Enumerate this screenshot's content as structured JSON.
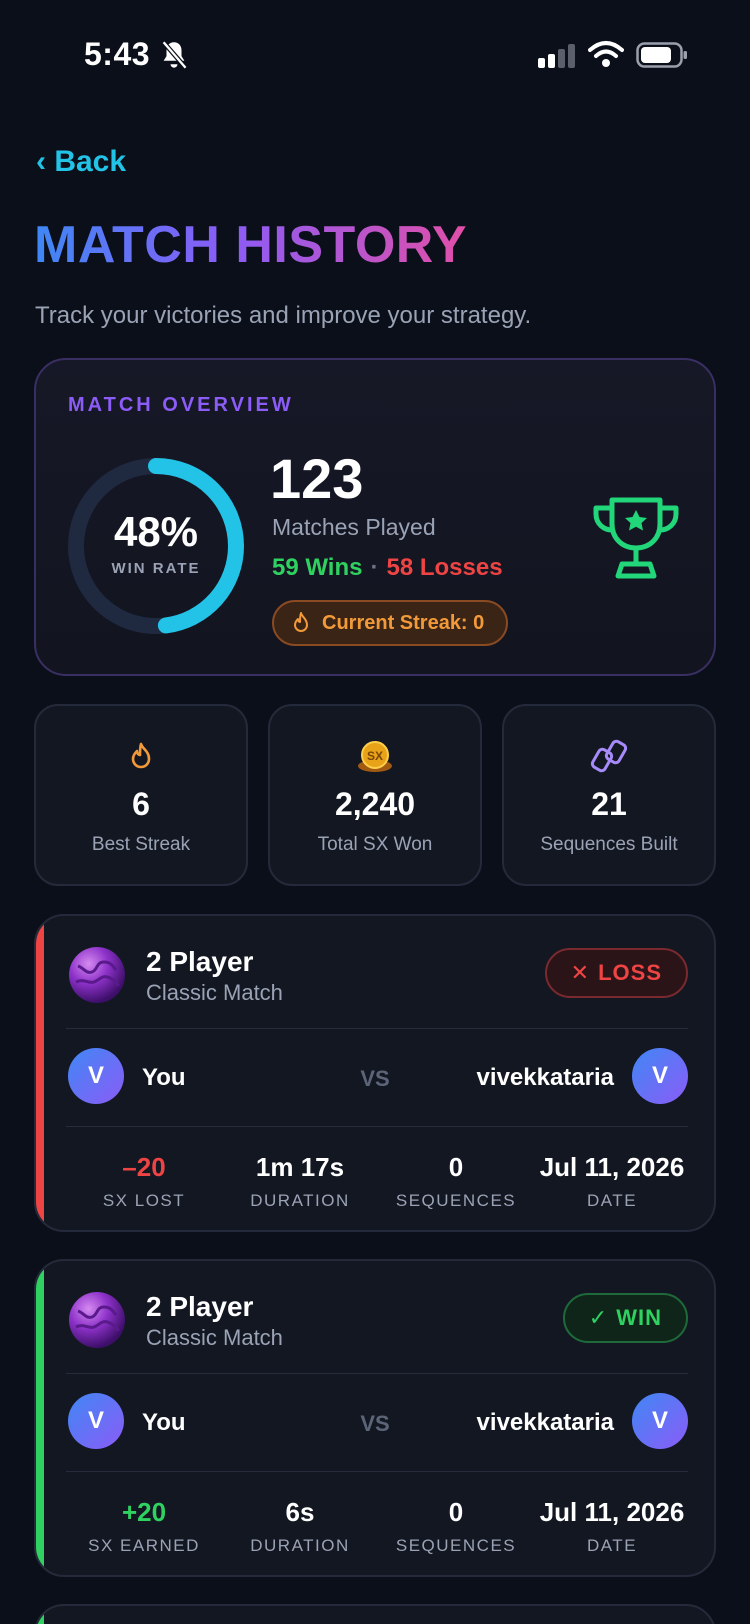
{
  "status_bar": {
    "time": "5:43"
  },
  "nav": {
    "back_label": "‹ Back"
  },
  "header": {
    "title": "MATCH HISTORY",
    "subtitle": "Track your victories and improve your strategy."
  },
  "overview": {
    "label": "MATCH OVERVIEW",
    "win_rate_text": "48%",
    "win_rate_fraction": 0.48,
    "win_rate_caption": "WIN RATE",
    "matches_played": "123",
    "matches_caption": "Matches Played",
    "wins": "59 Wins",
    "separator": "·",
    "losses": "58 Losses",
    "current_streak": "Current Streak: 0"
  },
  "stats": [
    {
      "icon": "flame-icon",
      "value": "6",
      "caption": "Best Streak"
    },
    {
      "icon": "sx-coin-icon",
      "coin_text": "SX",
      "value": "2,240",
      "caption": "Total SX Won"
    },
    {
      "icon": "link-icon",
      "value": "21",
      "caption": "Sequences Built"
    }
  ],
  "matches": [
    {
      "mode": "2 Player",
      "type": "Classic Match",
      "result": "LOSS",
      "result_icon": "✕",
      "player": "You",
      "player_initial": "V",
      "vs": "VS",
      "opponent": "vivekkataria",
      "opponent_initial": "V",
      "sx_value": "–20",
      "sx_caption": "SX LOST",
      "duration": "1m 17s",
      "duration_caption": "DURATION",
      "sequences": "0",
      "sequences_caption": "SEQUENCES",
      "date": "Jul 11, 2026",
      "date_caption": "DATE"
    },
    {
      "mode": "2 Player",
      "type": "Classic Match",
      "result": "WIN",
      "result_icon": "✓",
      "player": "You",
      "player_initial": "V",
      "vs": "VS",
      "opponent": "vivekkataria",
      "opponent_initial": "V",
      "sx_value": "+20",
      "sx_caption": "SX EARNED",
      "duration": "6s",
      "duration_caption": "DURATION",
      "sequences": "0",
      "sequences_caption": "SEQUENCES",
      "date": "Jul 11, 2026",
      "date_caption": "DATE"
    }
  ],
  "colors": {
    "accent_cyan": "#22c3e6",
    "purple": "#8b5cf6",
    "win_green": "#2fd160",
    "loss_red": "#ef4444",
    "streak_orange": "#f29a3a",
    "background": "#0b0f1a"
  }
}
